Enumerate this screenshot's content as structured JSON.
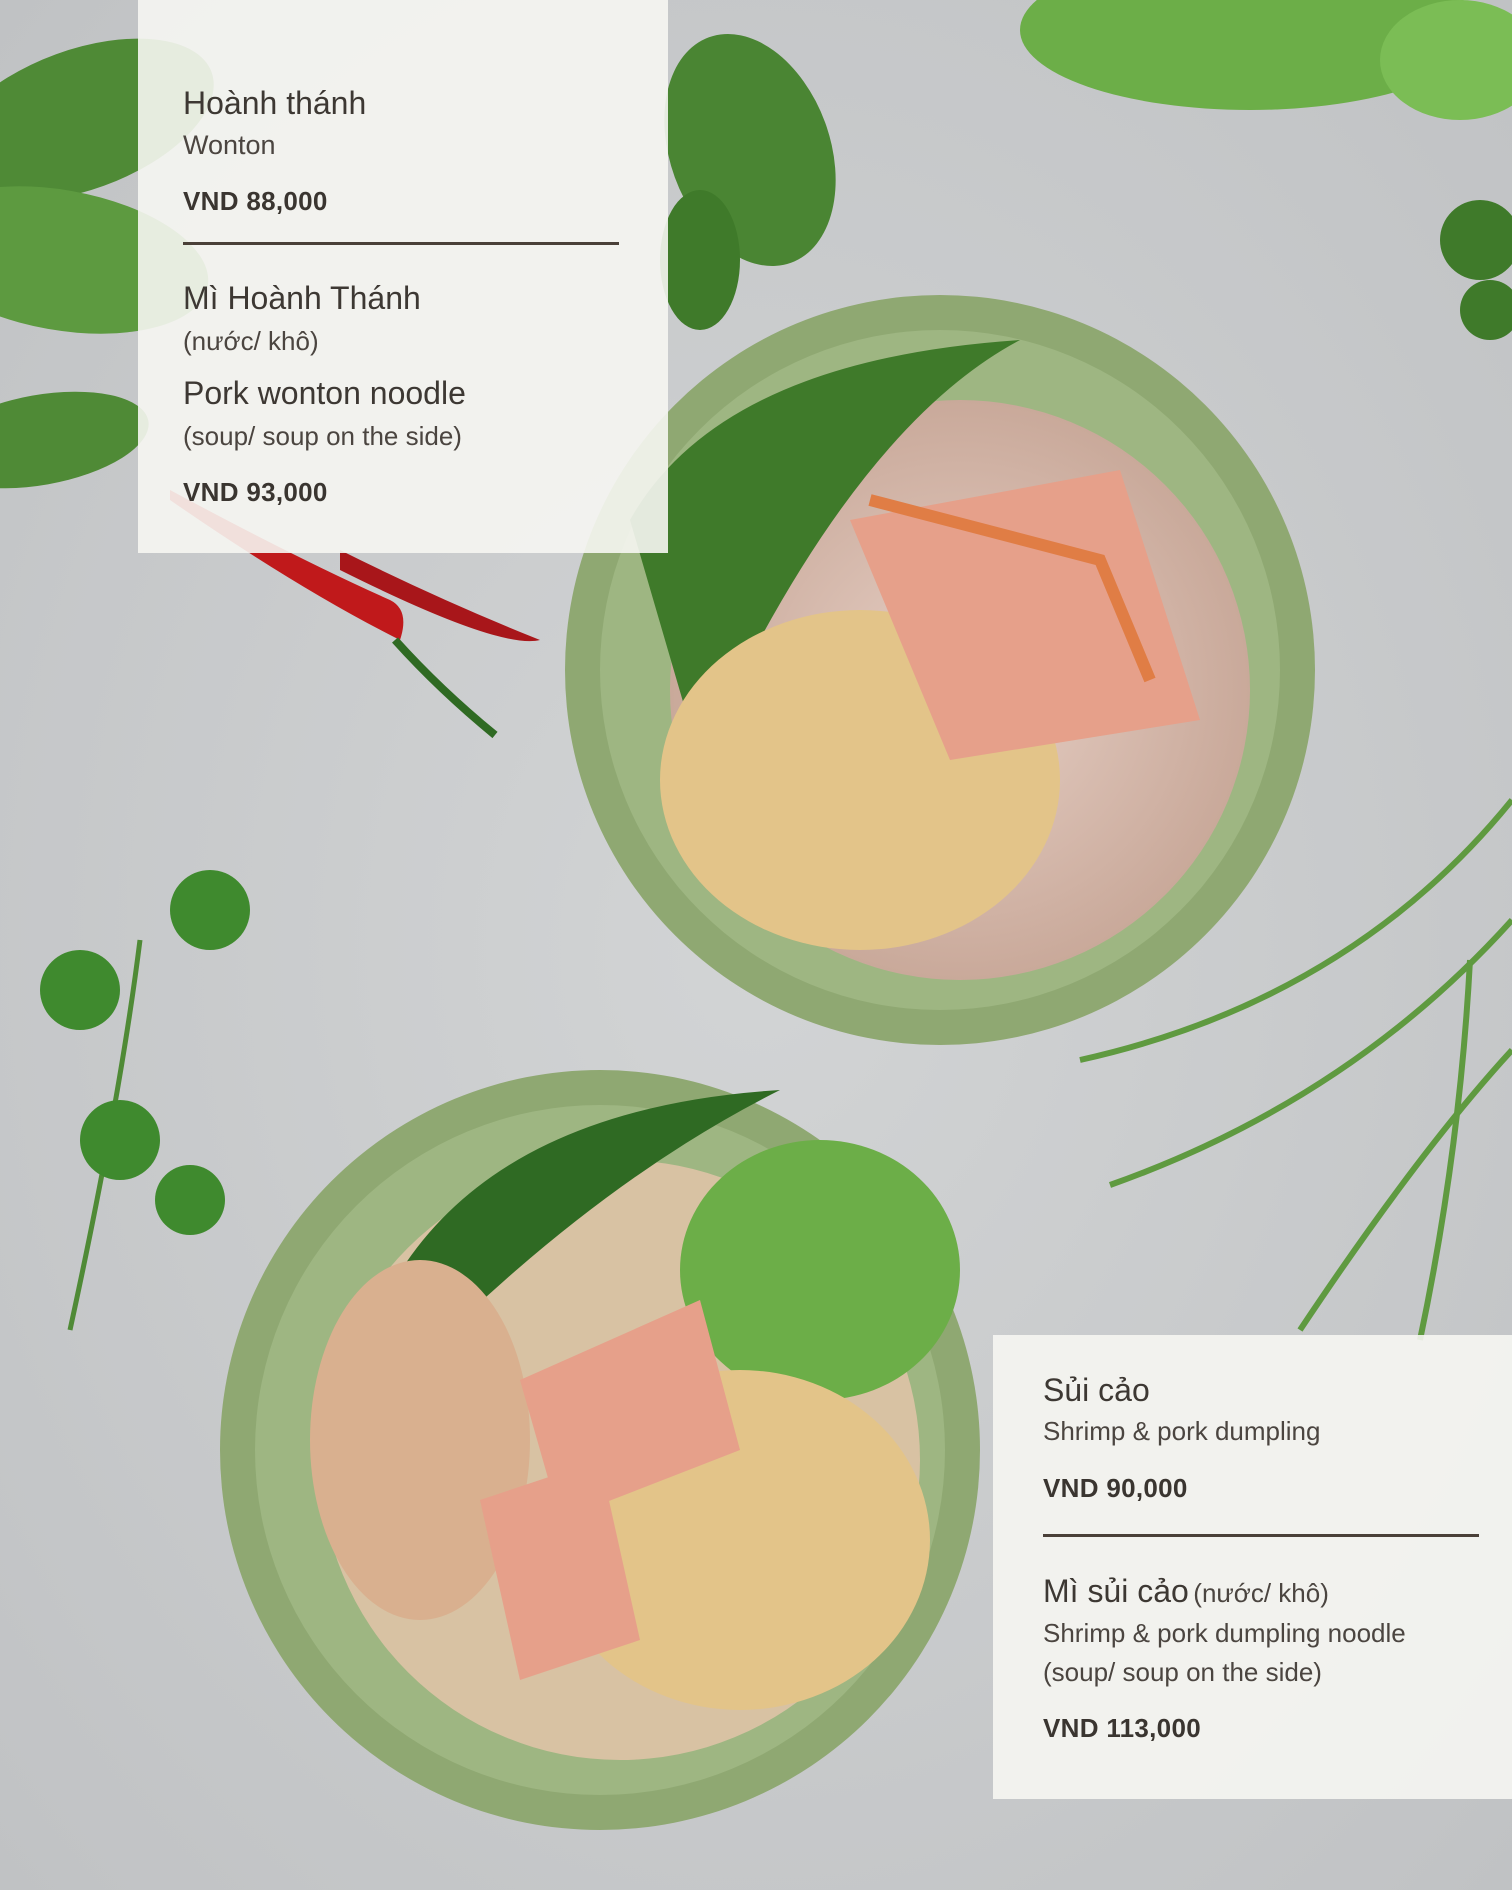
{
  "top_panel": {
    "item1": {
      "title": "Hoành thánh",
      "subtitle": "Wonton",
      "price": "VND 88,000"
    },
    "item2": {
      "title": "Mì Hoành Thánh",
      "title_note": "(nước/ khô)",
      "english_title": "Pork wonton  noodle",
      "english_note": "(soup/ soup on the side)",
      "price": "VND 93,000"
    }
  },
  "bottom_panel": {
    "item1": {
      "title": "Sủi cảo",
      "subtitle": "Shrimp & pork dumpling",
      "price": "VND 90,000"
    },
    "item2": {
      "title": "Mì sủi cảo",
      "title_note": "(nước/ khô)",
      "subtitle": "Shrimp & pork dumpling noodle",
      "subtitle_note": "(soup/ soup on the side)",
      "price": "VND 113,000"
    }
  },
  "colors": {
    "background": "#c9cbcc",
    "bowl": "#8fa872",
    "greens": "#3f7a2a",
    "chili": "#c0191b",
    "noodle": "#e3c489",
    "pork": "#e6a08a"
  }
}
